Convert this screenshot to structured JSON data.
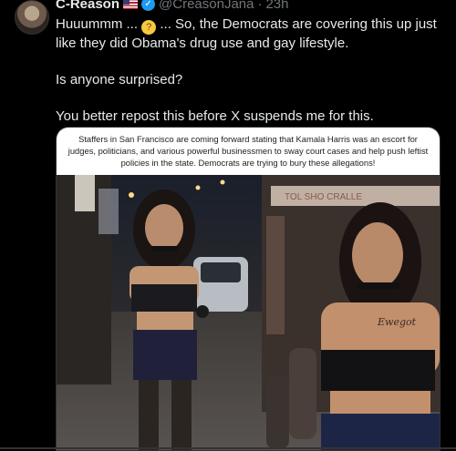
{
  "tweet": {
    "author_name": "C-Reason",
    "handle": "@CreasonJana",
    "separator": "·",
    "time": "23h",
    "text_line1": "Huuummm ... ",
    "emoji": "🤔",
    "text_line1b": " ... So, the Democrats are covering this up just like they did Obama's drug use and gay lifestyle.",
    "text_line2": "Is anyone surprised?",
    "text_line3": "You better repost this before X suspends me for this."
  },
  "media": {
    "caption": "Staffers in San Francisco are coming forward stating that Kamala Harris was an escort for judges, politicians, and various powerful businessmen to sway court cases and help push leftist policies in the state. Democrats are trying to bury these allegations!",
    "sign_text": "TOL   SHO CRALLE",
    "chest_text": "Ewegot"
  },
  "colors": {
    "background": "#000000",
    "text": "#e7e9ea",
    "muted": "#71767b",
    "verified": "#1d9bf0"
  }
}
